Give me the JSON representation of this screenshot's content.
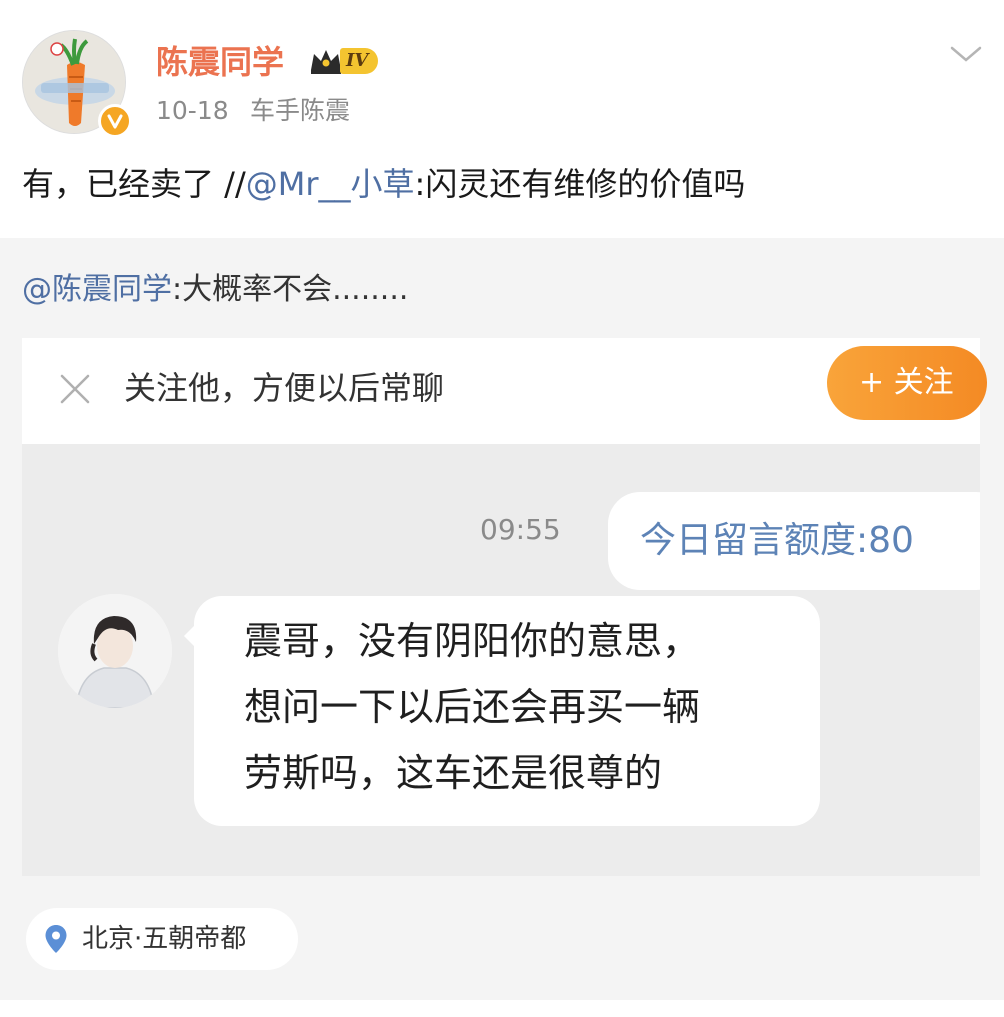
{
  "header": {
    "username": "陈震同学",
    "vip_level": "IV",
    "date": "10-18",
    "source": "车手陈震",
    "avatar_icon": "carrot-avatar",
    "verified_icon": "verified-v-badge",
    "more_icon": "chevron-down-icon"
  },
  "post": {
    "text_before": "有，已经卖了 //",
    "mention": "@Mr__小草",
    "text_after": ":闪灵还有维修的价值吗"
  },
  "repost": {
    "mention": "@陈震同学",
    "text": ":大概率不会........"
  },
  "follow_bar": {
    "prompt": "关注他，方便以后常聊",
    "button_label": "+ 关注",
    "close_icon": "close-icon"
  },
  "chat": {
    "time": "09:55",
    "right_bubble": "今日留言额度:80",
    "left_bubble_lines": [
      "震哥，没有阴阳你的意思，",
      "想问一下以后还会再买一辆",
      "劳斯吗，这车还是很尊的"
    ]
  },
  "location": {
    "city": "北京",
    "separator": "·",
    "name": "五朝帝都",
    "icon": "location-pin-icon"
  },
  "colors": {
    "username": "#eb7350",
    "mention": "#4f6fa3",
    "follow_button": "#f48a24",
    "chat_time": "#8a8a8a",
    "right_bubble_text": "#5d83b6",
    "repost_bg": "#f4f4f4",
    "chat_bg": "#ececec"
  }
}
